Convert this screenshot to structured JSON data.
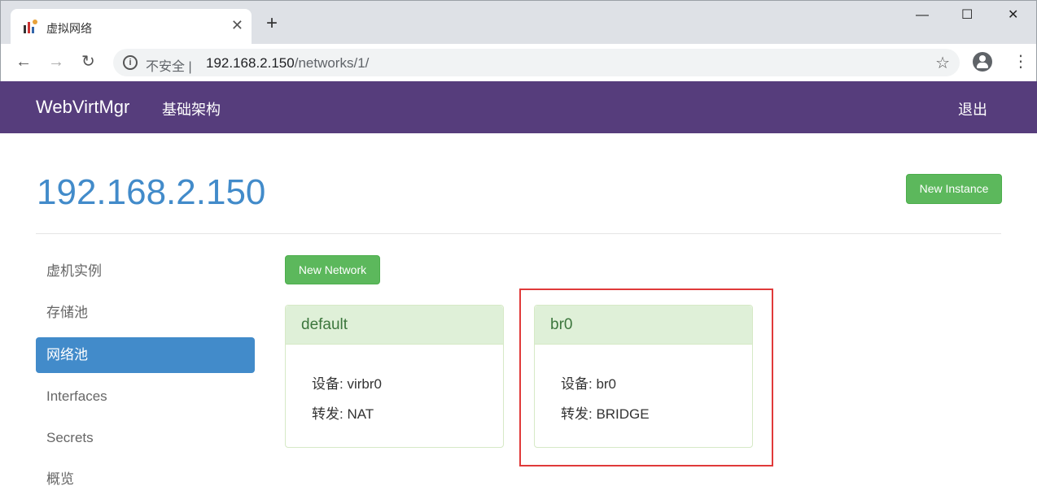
{
  "browser": {
    "tab_title": "虚拟网络",
    "close_glyph": "✕",
    "newtab_glyph": "+",
    "minimize_glyph": "—",
    "maximize_glyph": "☐",
    "winclose_glyph": "✕",
    "back_glyph": "←",
    "forward_glyph": "→",
    "reload_glyph": "↻",
    "info_glyph": "i",
    "security_label": "不安全 |",
    "url_host": "192.168.2.150",
    "url_path": "/networks/1/",
    "star_glyph": "☆",
    "menu_glyph": "⋮"
  },
  "navbar": {
    "brand": "WebVirtMgr",
    "infrastructure": "基础架构",
    "logout": "退出"
  },
  "page": {
    "title": "192.168.2.150",
    "new_instance": "New Instance",
    "new_network": "New Network"
  },
  "sidebar": {
    "items": [
      {
        "label": "虚机实例",
        "active": false
      },
      {
        "label": "存储池",
        "active": false
      },
      {
        "label": "网络池",
        "active": true
      },
      {
        "label": "Interfaces",
        "active": false
      },
      {
        "label": "Secrets",
        "active": false
      },
      {
        "label": "概览",
        "active": false
      }
    ]
  },
  "networks": [
    {
      "name": "default",
      "device": "设备: virbr0",
      "forward": "转发: NAT"
    },
    {
      "name": "br0",
      "device": "设备: br0",
      "forward": "转发: BRIDGE"
    }
  ],
  "colors": {
    "navbar": "#563d7c",
    "accent": "#428bca",
    "success": "#5cb85c",
    "highlight": "#e03a3a"
  }
}
